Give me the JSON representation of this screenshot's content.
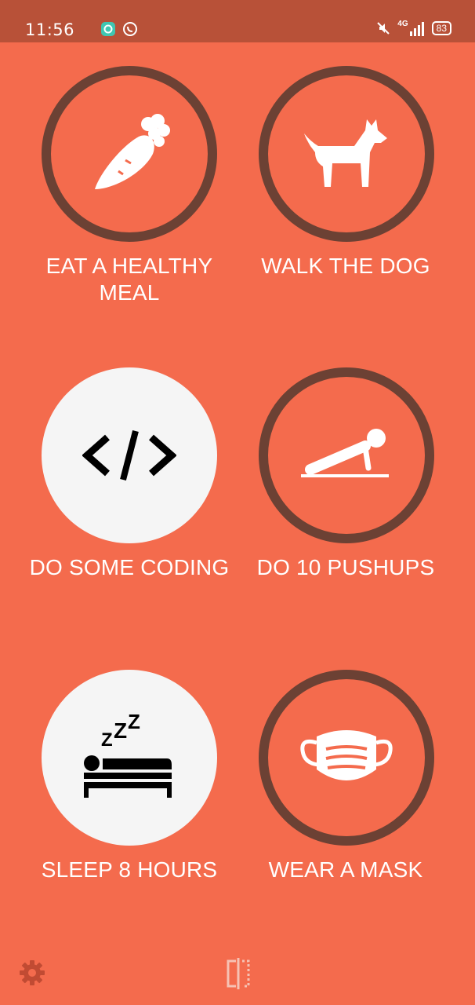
{
  "status_bar": {
    "time": "11:56",
    "left_icons": [
      "chat-app-icon",
      "whatsapp-icon"
    ],
    "right_icons": [
      "mute-icon",
      "signal-4g-icon",
      "battery-icon"
    ],
    "network": "4G",
    "battery": "83"
  },
  "habits": [
    {
      "label": "EAT A HEALTHY MEAL",
      "icon": "carrot-icon",
      "completed": false
    },
    {
      "label": "WALK THE DOG",
      "icon": "dog-icon",
      "completed": false
    },
    {
      "label": "DO SOME CODING",
      "icon": "code-icon",
      "completed": true
    },
    {
      "label": "DO 10 PUSHUPS",
      "icon": "pushup-icon",
      "completed": false
    },
    {
      "label": "SLEEP 8 HOURS",
      "icon": "sleep-icon",
      "completed": true
    },
    {
      "label": "WEAR A MASK",
      "icon": "mask-icon",
      "completed": false
    }
  ],
  "bottom_bar": {
    "left_icon": "settings-icon",
    "center_icon": "split-view-icon"
  },
  "colors": {
    "background": "#f46b4d",
    "status_bar": "#b85138",
    "ring": "#6c4134",
    "completed_fill": "#f5f5f5"
  }
}
